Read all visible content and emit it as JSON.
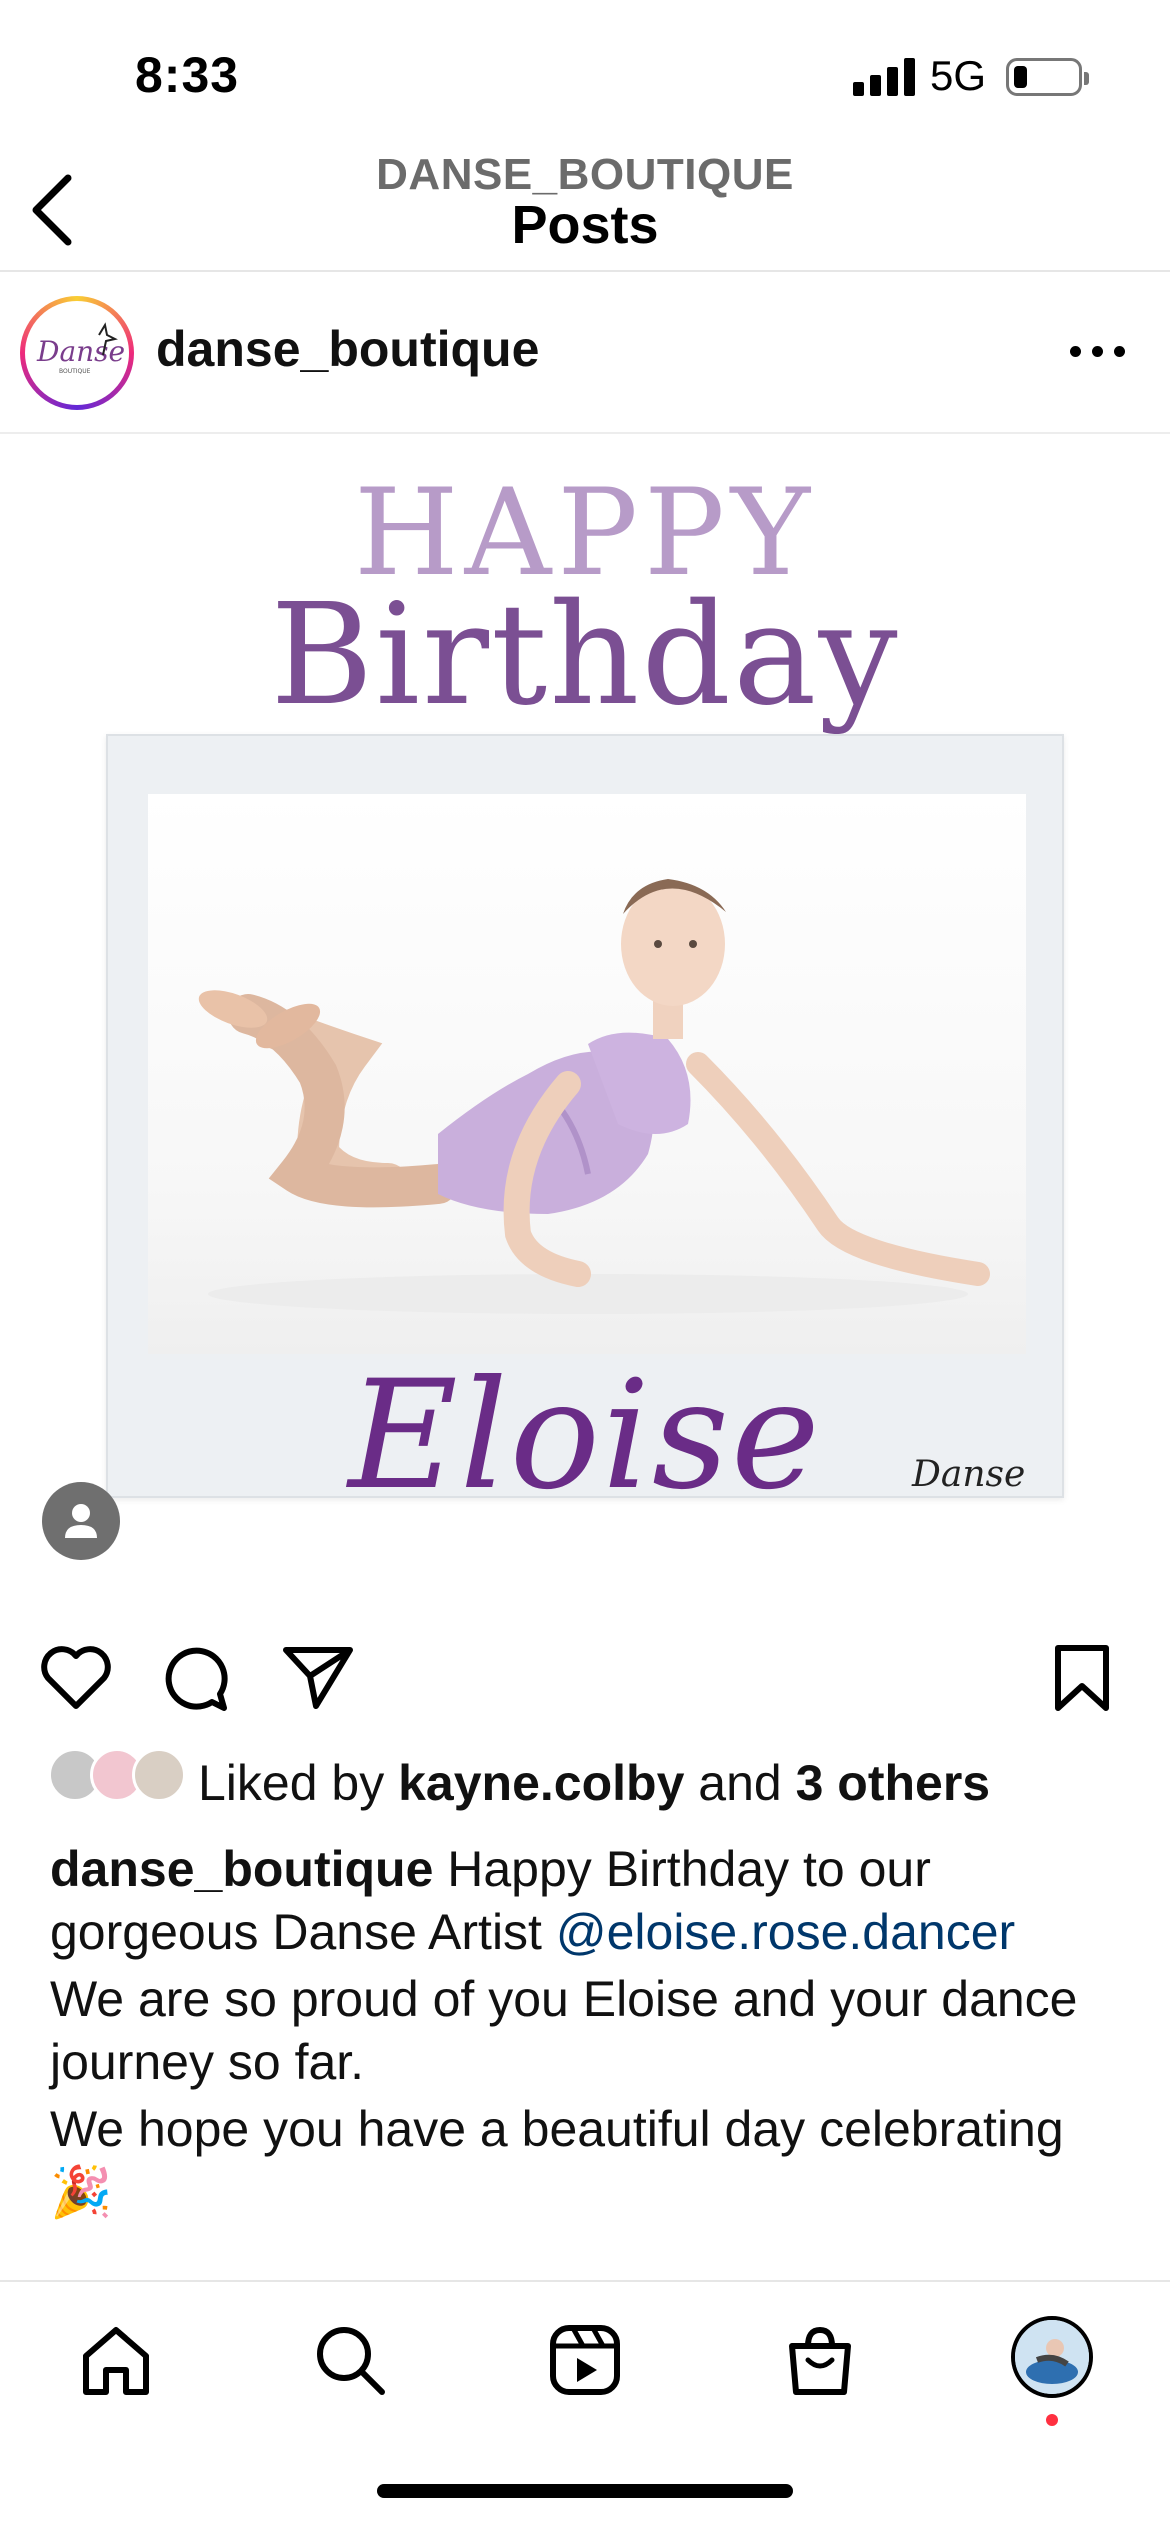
{
  "status_bar": {
    "time": "8:33",
    "network": "5G",
    "battery_level": 0.2
  },
  "header": {
    "account": "DANSE_BOUTIQUE",
    "title": "Posts"
  },
  "post": {
    "username": "danse_boutique",
    "image": {
      "line1": "HAPPY",
      "line2": "Birthday",
      "name_script": "Eloise",
      "watermark": "Danse"
    },
    "likes": {
      "prefix": "Liked by ",
      "user": "kayne.colby",
      "middle": " and ",
      "others": "3 others"
    },
    "caption": {
      "user": "danse_boutique",
      "text1": " Happy Birthday to our gorgeous Danse Artist ",
      "mention": "@eloise.rose.dancer",
      "text2": "We are so proud of you Eloise and your dance journey so far.",
      "text3": "We hope you have a beautiful day celebrating",
      "emoji": "🎉"
    }
  },
  "icons": {
    "back": "back-chevron-icon",
    "more": "more-icon",
    "like": "heart-icon",
    "comment": "comment-icon",
    "share": "send-icon",
    "save": "bookmark-icon",
    "home": "home-icon",
    "search": "search-icon",
    "reels": "reels-icon",
    "shop": "shop-icon",
    "tag": "person-tag-icon"
  },
  "colors": {
    "happy": "#b79bc8",
    "birthday": "#7b4f93",
    "eloise": "#6a2c87",
    "mention": "#00376b",
    "notification": "#ff3040"
  }
}
